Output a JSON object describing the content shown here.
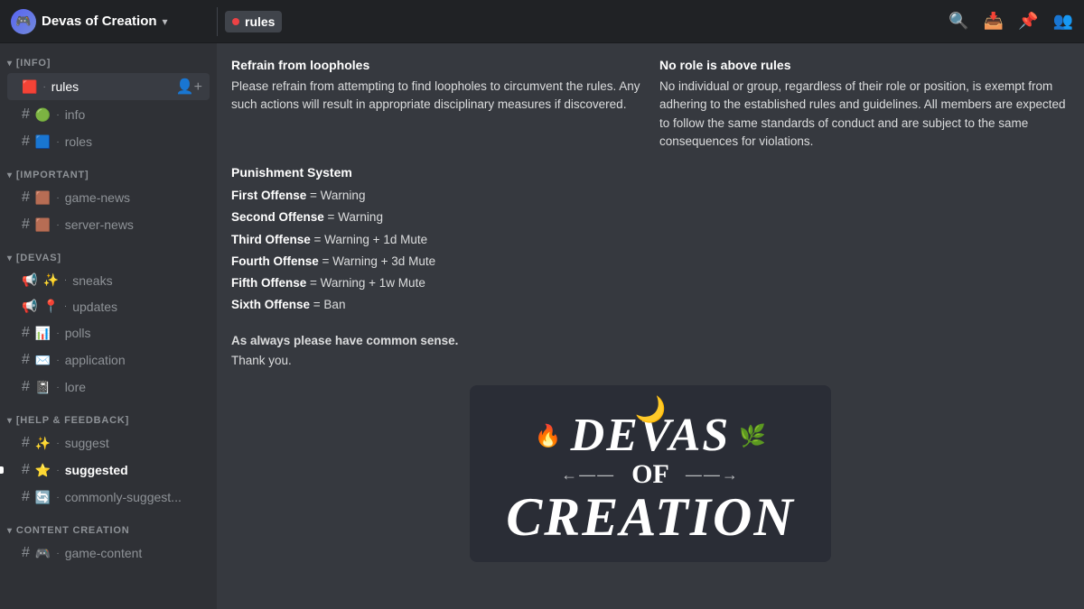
{
  "titlebar": {
    "server_name": "Devas of Creation",
    "channel_name": "rules",
    "icons": [
      "search",
      "inbox",
      "pin",
      "members"
    ]
  },
  "sidebar": {
    "categories": [
      {
        "name": "[INFO]",
        "channels": [
          {
            "type": "hash",
            "name": "rules",
            "emoji": "🟥",
            "active": true
          },
          {
            "type": "hash",
            "name": "info",
            "emoji": "🟢"
          },
          {
            "type": "hash",
            "name": "roles",
            "emoji": "🟦"
          }
        ]
      },
      {
        "name": "[IMPORTANT]",
        "channels": [
          {
            "type": "hash",
            "name": "game-news",
            "emoji": "🟫"
          },
          {
            "type": "hash",
            "name": "server-news",
            "emoji": "🟫"
          }
        ]
      },
      {
        "name": "[DEVAS]",
        "channels": [
          {
            "type": "megaphone",
            "name": "sneaks",
            "emoji": "✨"
          },
          {
            "type": "megaphone",
            "name": "updates",
            "emoji": "📍"
          },
          {
            "type": "hash",
            "name": "polls",
            "emoji": "📊"
          },
          {
            "type": "hash",
            "name": "application",
            "emoji": "✉️"
          },
          {
            "type": "hash",
            "name": "lore",
            "emoji": "📓"
          }
        ]
      },
      {
        "name": "[HELP & FEEDBACK]",
        "channels": [
          {
            "type": "hash",
            "name": "suggest",
            "emoji": "✨"
          },
          {
            "type": "hash",
            "name": "suggested",
            "emoji": "⭐",
            "unread": true
          },
          {
            "type": "hash",
            "name": "commonly-suggest...",
            "emoji": "🔄"
          }
        ]
      },
      {
        "name": "CONTENT CREATION",
        "channels": [
          {
            "type": "hash",
            "name": "game-content",
            "emoji": "🎮"
          }
        ]
      }
    ]
  },
  "chat": {
    "channel_name": "rules",
    "sections": [
      {
        "left_title": "Refrain from loopholes",
        "left_text": "Please refrain from attempting to find loopholes to circumvent the rules. Any such actions will result in appropriate disciplinary measures if discovered.",
        "right_title": "No role is above rules",
        "right_text": "No individual or group, regardless of their role or position, is exempt from adhering to the established rules and guidelines. All members are expected to follow the same standards of conduct and are subject to the same consequences for violations."
      }
    ],
    "punishment_system": {
      "title": "Punishment System",
      "offenses": [
        {
          "label": "First Offense",
          "value": "= Warning"
        },
        {
          "label": "Second Offense",
          "value": "= Warning"
        },
        {
          "label": "Third Offense",
          "value": "= Warning + 1d Mute"
        },
        {
          "label": "Fourth Offense",
          "value": "= Warning + 3d Mute"
        },
        {
          "label": "Fifth Offense",
          "value": "= Warning + 1w Mute"
        },
        {
          "label": "Sixth Offense",
          "value": "= Ban"
        }
      ]
    },
    "common_sense": "As always please have common sense.",
    "thank_you": "Thank you.",
    "logo": {
      "moon": "🌙",
      "fire": "🔥",
      "leaf": "🌿",
      "devas": "Devas",
      "of": "of",
      "creation": "Creation"
    }
  }
}
